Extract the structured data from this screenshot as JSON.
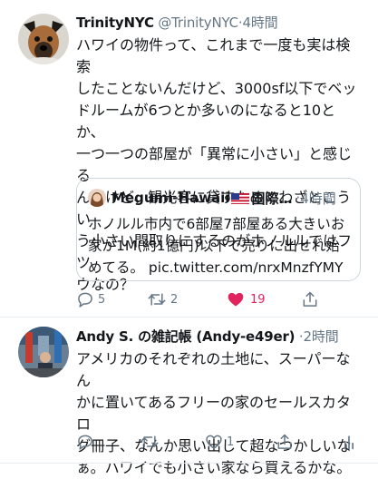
{
  "tweet1": {
    "name": "TrinityNYC",
    "handle": "@TrinityNYC",
    "separator": "·",
    "time": "4時間",
    "lines": [
      "ハワイの物件って、これまで一度も実は検索",
      "したことないんだけど、3000sf以下でベッ",
      "ドルームが6つとか多いのになると10とか、",
      "一つ一つの部屋が「異常に小さい」と感じる",
      "んだけど、観光客に貸すためにわざとこうい",
      "う小さい間取りにするのがホノルルではフツ",
      "ウなの？"
    ],
    "quote": {
      "name": "Megumi-Hawaii",
      "name_suffix": "国際…",
      "separator": "·",
      "time": "4時間",
      "lines": [
        "ホノルル市内で6部屋7部屋ある大きいお",
        "家が1M(約1億円)以下で売りに出せれ始",
        "めてる。 pic.twitter.com/nrxMnzfYMY"
      ]
    },
    "actions": {
      "reply_icon": "reply-icon",
      "reply_count": "5",
      "retweet_icon": "retweet-icon",
      "retweet_count": "2",
      "like_icon": "heart-filled-icon",
      "like_count": "19",
      "share_icon": "share-icon"
    }
  },
  "tweet2": {
    "name": "Andy S. の雑記帳 (Andy-e49er)",
    "separator": "·",
    "time": "2時間",
    "lines": [
      "アメリカのそれぞれの土地に、スーパーなん",
      "かに置いてあるフリーの家のセールスカタロ",
      "グ冊子、なんか思い出して超なつかしいな",
      "ぁ。ハワイでも小さい家なら買えるかな。"
    ],
    "actions": {
      "reply_icon": "reply-icon",
      "retweet_icon": "retweet-icon",
      "like_icon": "heart-outline-icon",
      "like_count": "1",
      "share_icon": "share-icon",
      "analytics_icon": "analytics-icon"
    }
  },
  "colors": {
    "text": "#14171a",
    "secondary": "#657786",
    "like": "#e0245e",
    "link": "#14171a",
    "divider": "#e6ecf0"
  }
}
